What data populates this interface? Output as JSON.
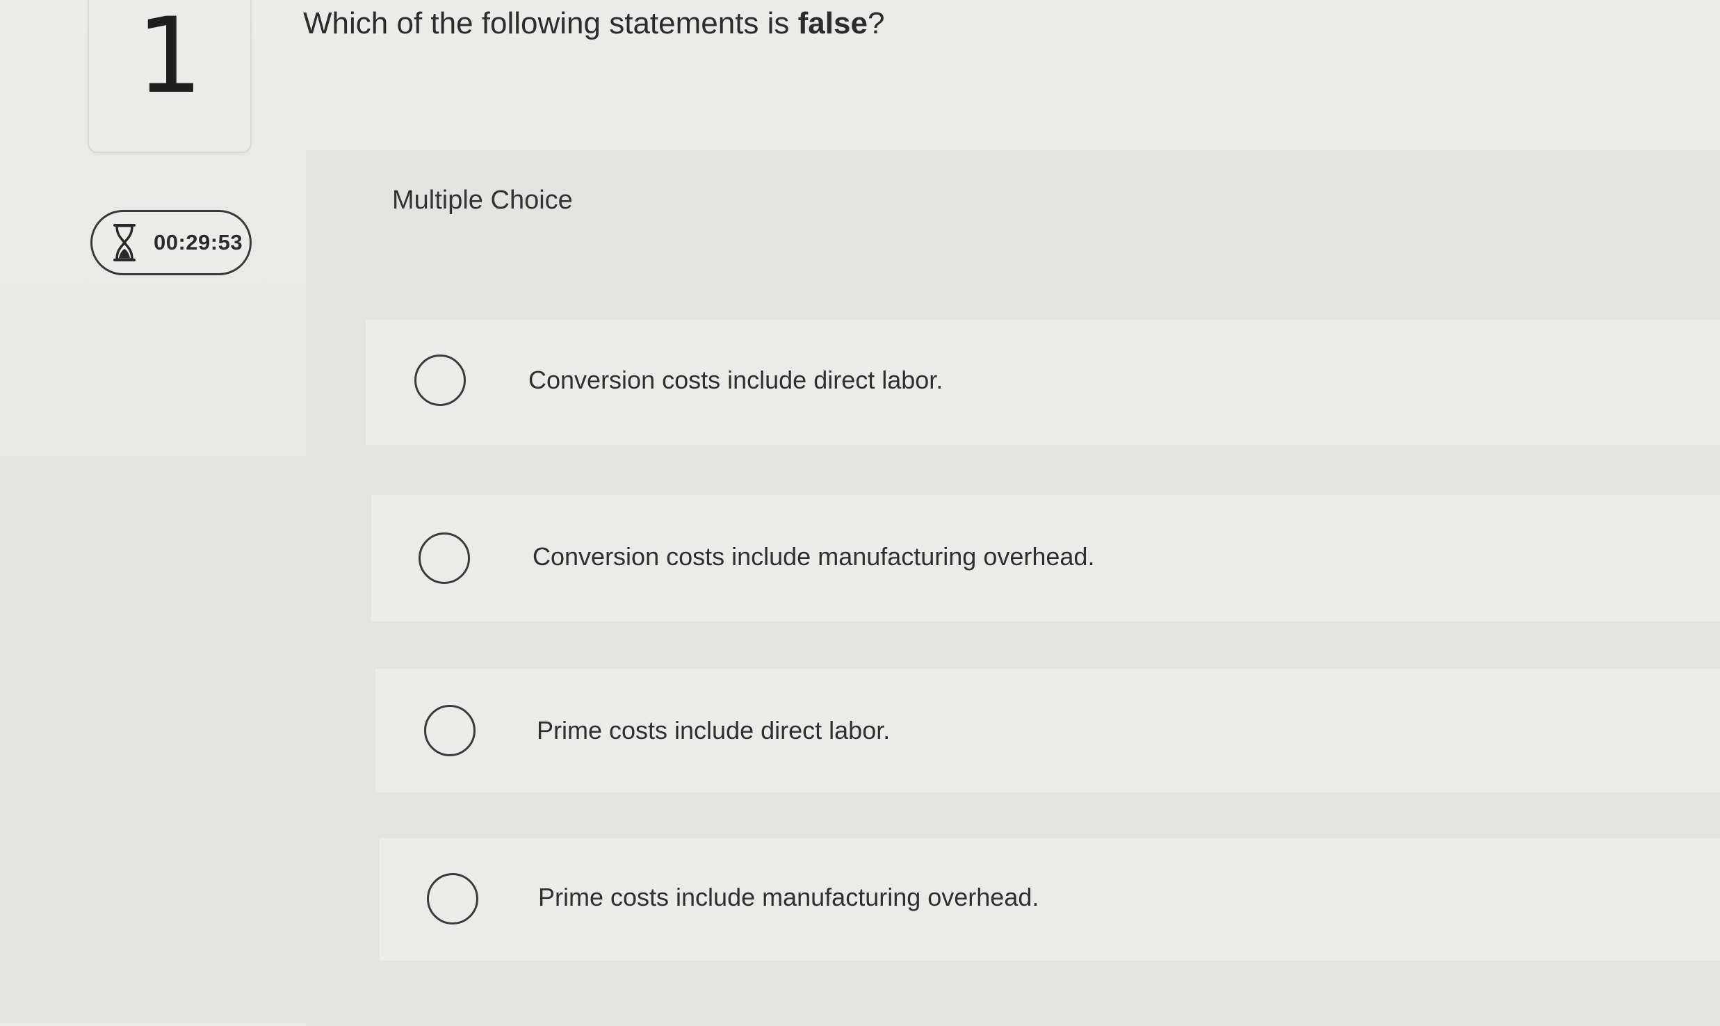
{
  "question": {
    "number": "1",
    "prompt_prefix": "Which of the following statements is ",
    "prompt_emphasis": "false",
    "prompt_suffix": "?"
  },
  "timer": {
    "icon": "hourglass-icon",
    "time": "00:29:53"
  },
  "answer_type": "Multiple Choice",
  "options": [
    {
      "label": "Conversion costs include direct labor.",
      "selected": false
    },
    {
      "label": "Conversion costs include manufacturing overhead.",
      "selected": false
    },
    {
      "label": "Prime costs include direct labor.",
      "selected": false
    },
    {
      "label": "Prime costs include manufacturing overhead.",
      "selected": false
    }
  ]
}
